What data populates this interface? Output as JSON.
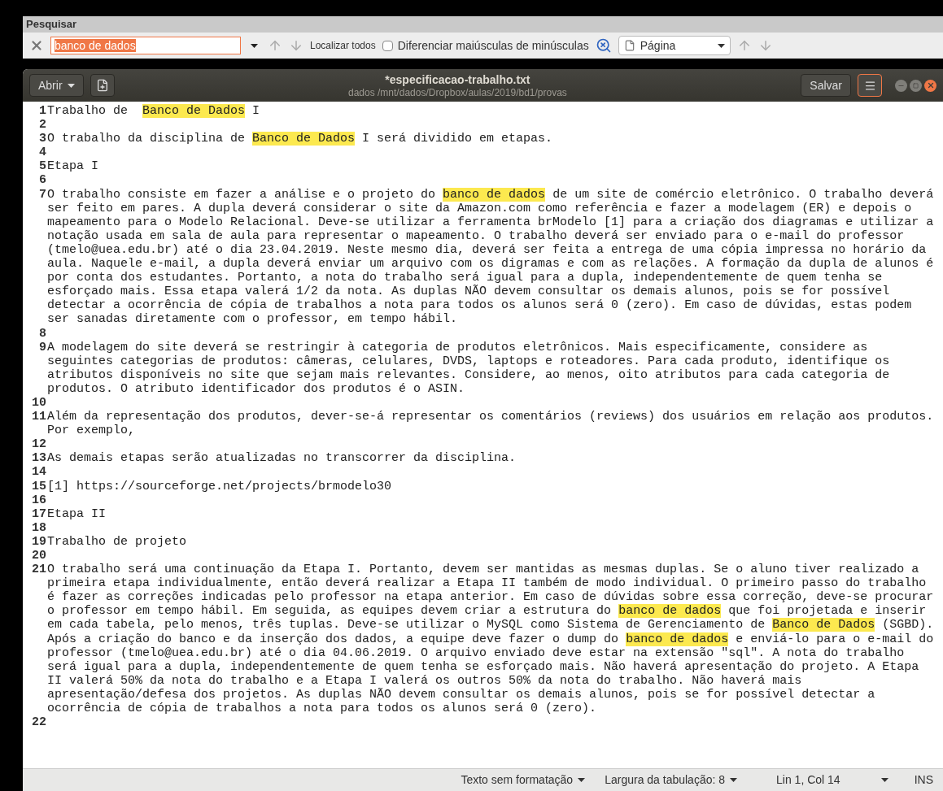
{
  "search_bar": {
    "title": "Pesquisar",
    "query": "banco de dados",
    "find_all": "Localizar todos",
    "match_case": {
      "label": "Diferenciar maiúsculas de minúsculas",
      "checked": false
    },
    "scope": "Página"
  },
  "editor": {
    "open_button": "Abrir",
    "title": "*especificacao-trabalho.txt",
    "path": "dados /mnt/dados/Dropbox/aulas/2019/bd1/provas",
    "save_button": "Salvar",
    "lines": [
      {
        "number": "1",
        "segments": [
          {
            "text": "Trabalho de  ",
            "highlighted": false
          },
          {
            "text": "Banco de Dados",
            "highlighted": true
          },
          {
            "text": " I",
            "highlighted": false
          }
        ]
      },
      {
        "number": "2"
      },
      {
        "number": "3",
        "segments": [
          {
            "text": "O trabalho da disciplina de ",
            "highlighted": false
          },
          {
            "text": "Banco de Dados",
            "highlighted": true
          },
          {
            "text": " I será dividido em etapas.",
            "highlighted": false
          }
        ]
      },
      {
        "number": "4"
      },
      {
        "number": "5",
        "segments": [
          {
            "text": "Etapa I",
            "highlighted": false
          }
        ]
      },
      {
        "number": "6"
      },
      {
        "number": "7",
        "segments": [
          {
            "text": "O trabalho consiste em fazer a análise e o projeto do ",
            "highlighted": false
          },
          {
            "text": "banco de dados",
            "highlighted": true
          },
          {
            "text": " de um site de comércio eletrônico. O trabalho deverá ser feito em pares. A dupla deverá considerar o site da Amazon.com como referência e fazer a modelagem (ER) e depois o mapeamento para o Modelo Relacional. Deve-se utilizar a ferramenta brModelo [1] para a criação dos diagramas e utilizar a notação usada em sala de aula para representar o mapeamento. O trabalho deverá ser enviado para o e-mail do professor (tmelo@uea.edu.br) até o dia 23.04.2019. Neste mesmo dia, deverá ser feita a entrega de uma cópia impressa no horário da aula. Naquele e-mail, a dupla deverá enviar um arquivo com os digramas e com as relações. A formação da dupla de alunos é por conta dos estudantes. Portanto, a nota do trabalho será igual para a dupla, independentemente de quem tenha se esforçado mais. Essa etapa valerá 1/2 da nota. As duplas NÃO devem consultar os demais alunos, pois se for possível detectar a ocorrência de cópia de trabalhos a nota para todos os alunos será 0 (zero). Em caso de dúvidas, estas podem ser sanadas diretamente com o professor, em tempo hábil.",
            "highlighted": false
          }
        ]
      },
      {
        "number": "8"
      },
      {
        "number": "9",
        "segments": [
          {
            "text": "A modelagem do site deverá se restringir à categoria de produtos eletrônicos. Mais especificamente, considere as seguintes categorias de produtos: câmeras, celulares, DVDS, laptops e roteadores. Para cada produto, identifique os atributos disponíveis no site que sejam mais relevantes. Considere, ao menos, oito atributos para cada categoria de produtos. O atributo identificador dos produtos é o ASIN.",
            "highlighted": false
          }
        ]
      },
      {
        "number": "10"
      },
      {
        "number": "11",
        "segments": [
          {
            "text": "Além da representação dos produtos, dever-se-á representar os comentários (reviews) dos usuários em relação aos produtos. Por exemplo,",
            "highlighted": false
          }
        ]
      },
      {
        "number": "12"
      },
      {
        "number": "13",
        "segments": [
          {
            "text": "As demais etapas serão atualizadas no transcorrer da disciplina.",
            "highlighted": false
          }
        ]
      },
      {
        "number": "14"
      },
      {
        "number": "15",
        "segments": [
          {
            "text": "[1] https://sourceforge.net/projects/brmodelo30",
            "highlighted": false
          }
        ]
      },
      {
        "number": "16"
      },
      {
        "number": "17",
        "segments": [
          {
            "text": "Etapa II",
            "highlighted": false
          }
        ]
      },
      {
        "number": "18"
      },
      {
        "number": "19",
        "segments": [
          {
            "text": "Trabalho de projeto",
            "highlighted": false
          }
        ]
      },
      {
        "number": "20"
      },
      {
        "number": "21",
        "segments": [
          {
            "text": "O trabalho será uma continuação da Etapa I. Portanto, devem ser mantidas as mesmas duplas. Se o aluno tiver realizado a primeira etapa individualmente, então deverá realizar a Etapa II também de modo individual. O primeiro passo do trabalho é fazer as correções indicadas pelo professor na etapa anterior. Em caso de dúvidas sobre essa correção, deve-se procurar o professor em tempo hábil. Em seguida, as equipes devem criar a estrutura do ",
            "highlighted": false
          },
          {
            "text": "banco de dados",
            "highlighted": true
          },
          {
            "text": " que foi projetada e inserir em cada tabela, pelo menos, três tuplas. Deve-se utilizar o MySQL como Sistema de Gerenciamento de ",
            "highlighted": false
          },
          {
            "text": "Banco de Dados",
            "highlighted": true
          },
          {
            "text": " (SGBD). Após a criação do banco e da inserção dos dados, a equipe deve fazer o dump do ",
            "highlighted": false
          },
          {
            "text": "banco de dados",
            "highlighted": true
          },
          {
            "text": " e enviá-lo para o e-mail do professor (tmelo@uea.edu.br) até o dia 04.06.2019. O arquivo enviado deve estar na extensão \"sql\". A nota do trabalho será igual para a dupla, independentemente de quem tenha se esforçado mais. Não haverá apresentação do projeto. A Etapa II valerá 50% da nota do trabalho e a Etapa I valerá os outros 50% da nota do trabalho. Não haverá mais apresentação/defesa dos projetos. As duplas NÃO devem consultar os demais alunos, pois se for possível detectar a ocorrência de cópia de trabalhos a nota para todos os alunos será 0 (zero).",
            "highlighted": false
          }
        ]
      },
      {
        "number": "22"
      }
    ]
  },
  "status_bar": {
    "language": "Texto sem formatação",
    "tab_width": "Largura da tabulação: 8",
    "position": "Lin 1, Col 14",
    "mode": "INS"
  }
}
